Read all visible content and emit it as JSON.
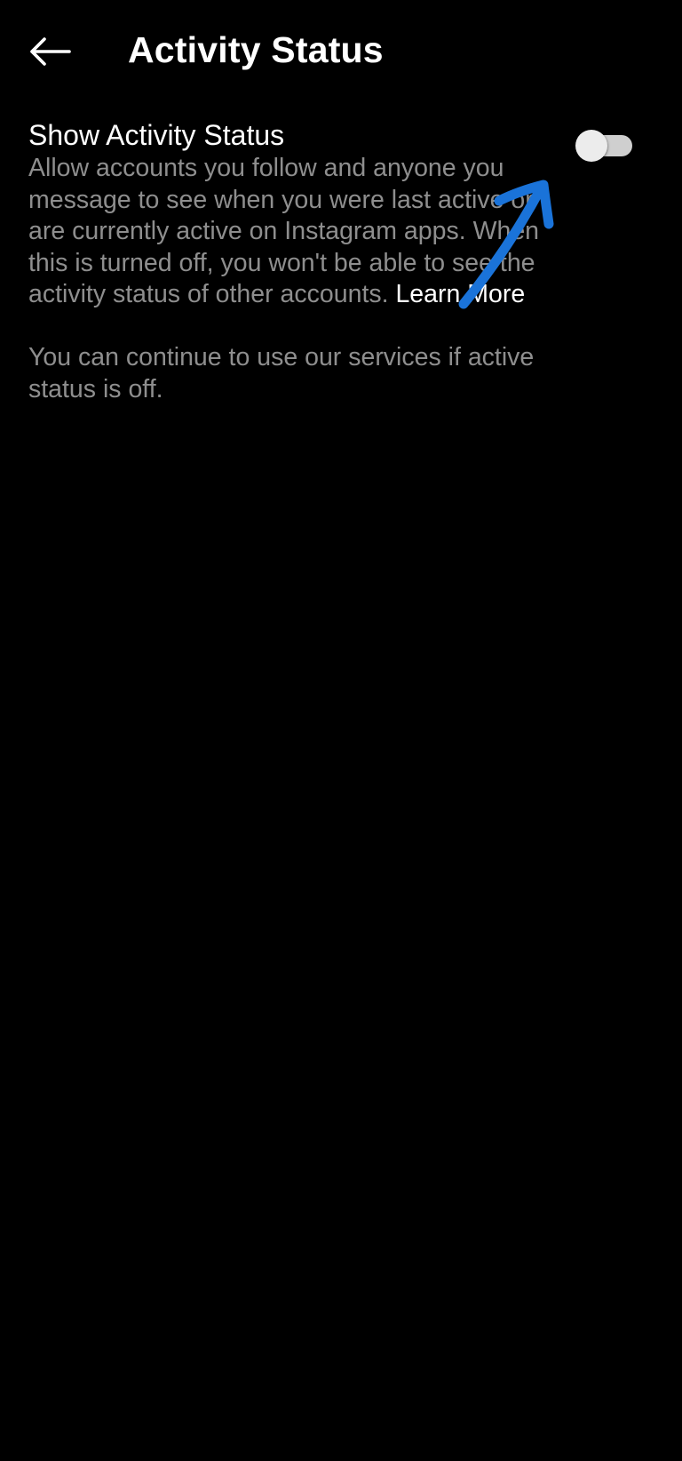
{
  "header": {
    "back_icon": "arrow-left-icon",
    "title": "Activity Status"
  },
  "setting": {
    "title": "Show Activity Status",
    "description": "Allow accounts you follow and anyone you message to see when you were last active or are currently active on Instagram apps. When this is turned off, you won't be able to see the activity status of other accounts.",
    "learn_more": "Learn More",
    "toggle_state": "off"
  },
  "note": {
    "text": "You can continue to use our services if active status is off."
  },
  "annotation": {
    "color": "#1a73d9",
    "icon": "hand-drawn-arrow-icon"
  }
}
